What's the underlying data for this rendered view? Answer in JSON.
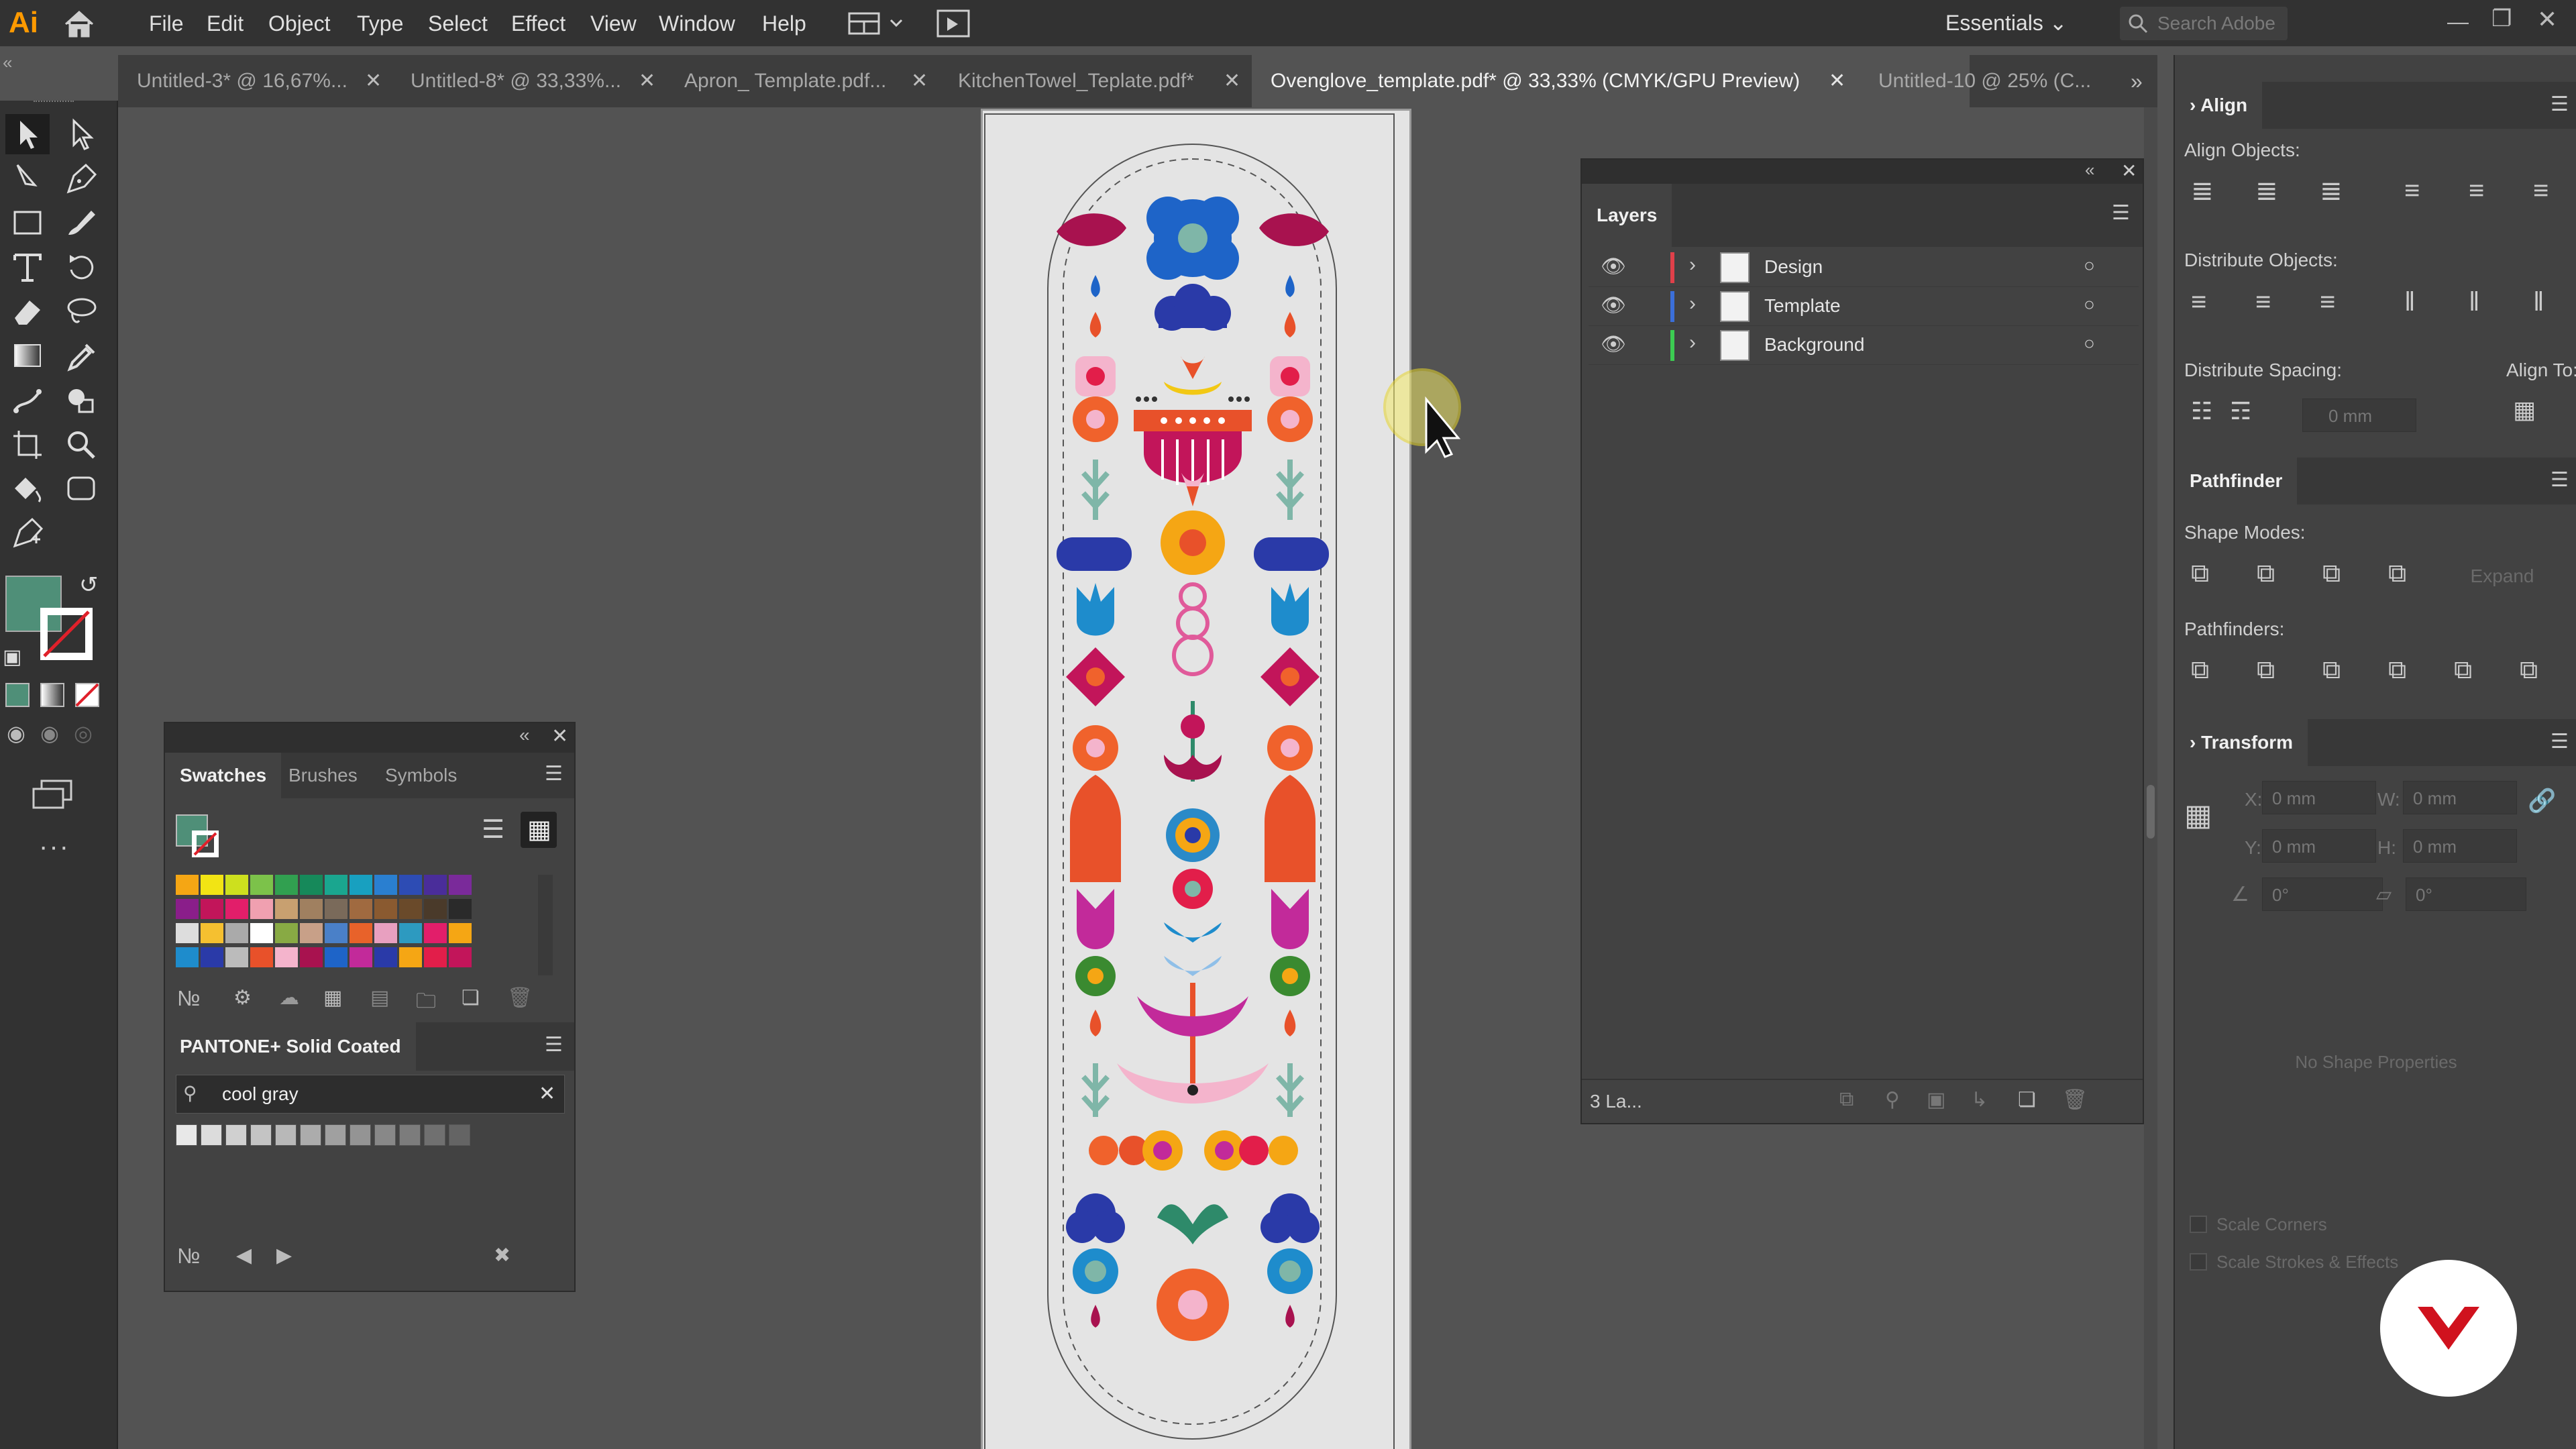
{
  "app": {
    "logo": "Ai",
    "workspace": "Essentials",
    "search_placeholder": "Search Adobe"
  },
  "menu": [
    "File",
    "Edit",
    "Object",
    "Type",
    "Select",
    "Effect",
    "View",
    "Window",
    "Help"
  ],
  "tabs": [
    {
      "label": "Untitled-3* @ 16,67%...",
      "active": false
    },
    {
      "label": "Untitled-8* @ 33,33%...",
      "active": false
    },
    {
      "label": "Apron_ Template.pdf...",
      "active": false
    },
    {
      "label": "KitchenTowel_Teplate.pdf*",
      "active": false
    },
    {
      "label": "Ovenglove_template.pdf* @ 33,33% (CMYK/GPU Preview)",
      "active": true
    },
    {
      "label": "Untitled-10 @ 25% (C...",
      "active": false
    }
  ],
  "swatches_panel": {
    "tabs": [
      "Swatches",
      "Brushes",
      "Symbols"
    ],
    "fill_color": "#4f8f78",
    "library_title": "PANTONE+ Solid Coated",
    "search_value": "cool gray"
  },
  "layers_panel": {
    "title": "Layers",
    "layers": [
      {
        "name": "Design",
        "color": "#e0404a"
      },
      {
        "name": "Template",
        "color": "#3b6fd9"
      },
      {
        "name": "Background",
        "color": "#3ccc52"
      }
    ],
    "count": "3 La..."
  },
  "align_panel": {
    "title": "Align",
    "align_objects": "Align Objects:",
    "distribute_objects": "Distribute Objects:",
    "distribute_spacing": "Distribute Spacing:",
    "align_to": "Align To:",
    "spacing_value": "0 mm"
  },
  "pathfinder_panel": {
    "title": "Pathfinder",
    "shape_modes": "Shape Modes:",
    "expand": "Expand",
    "pathfinders": "Pathfinders:"
  },
  "transform_panel": {
    "title": "Transform",
    "x_label": "X:",
    "x_value": "0 mm",
    "y_label": "Y:",
    "y_value": "0 mm",
    "w_label": "W:",
    "w_value": "0 mm",
    "h_label": "H:",
    "h_value": "0 mm",
    "angle_value": "0°",
    "shear_value": "0°",
    "no_shape": "No Shape Properties",
    "scale_corners": "Scale Corners",
    "scale_strokes": "Scale Strokes & Effects"
  }
}
